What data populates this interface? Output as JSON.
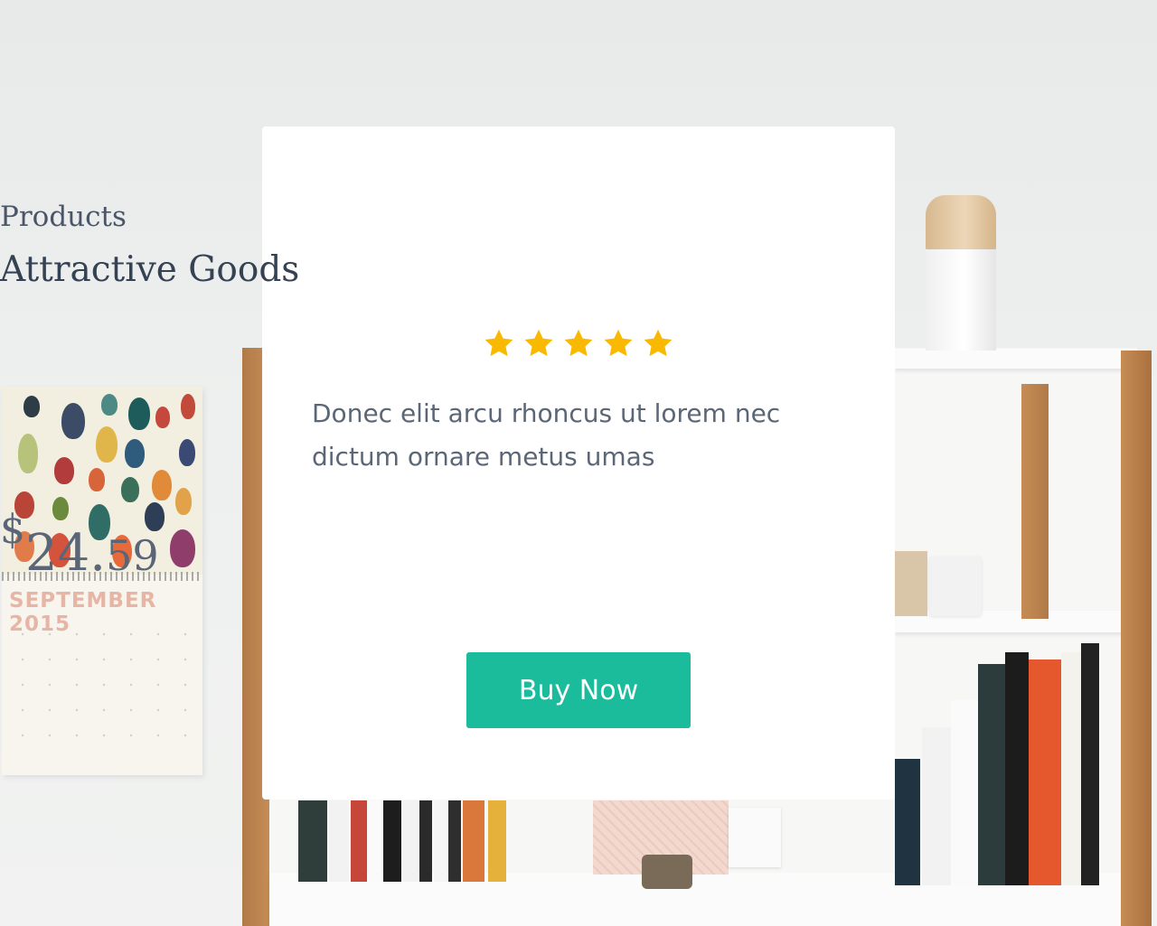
{
  "card": {
    "category": "Products",
    "title": "Attractive Goods",
    "rating": 5,
    "rating_max": 5,
    "star_color": "#F9B900",
    "description": "Donec elit arcu rhoncus ut lorem nec dictum ornare metus umas",
    "price": {
      "currency": "$",
      "whole": "24.",
      "cents": "59"
    },
    "button_label": "Buy Now",
    "button_color": "#1ABC9C"
  },
  "background": {
    "calendar_month": "SEPTEMBER 2015"
  }
}
